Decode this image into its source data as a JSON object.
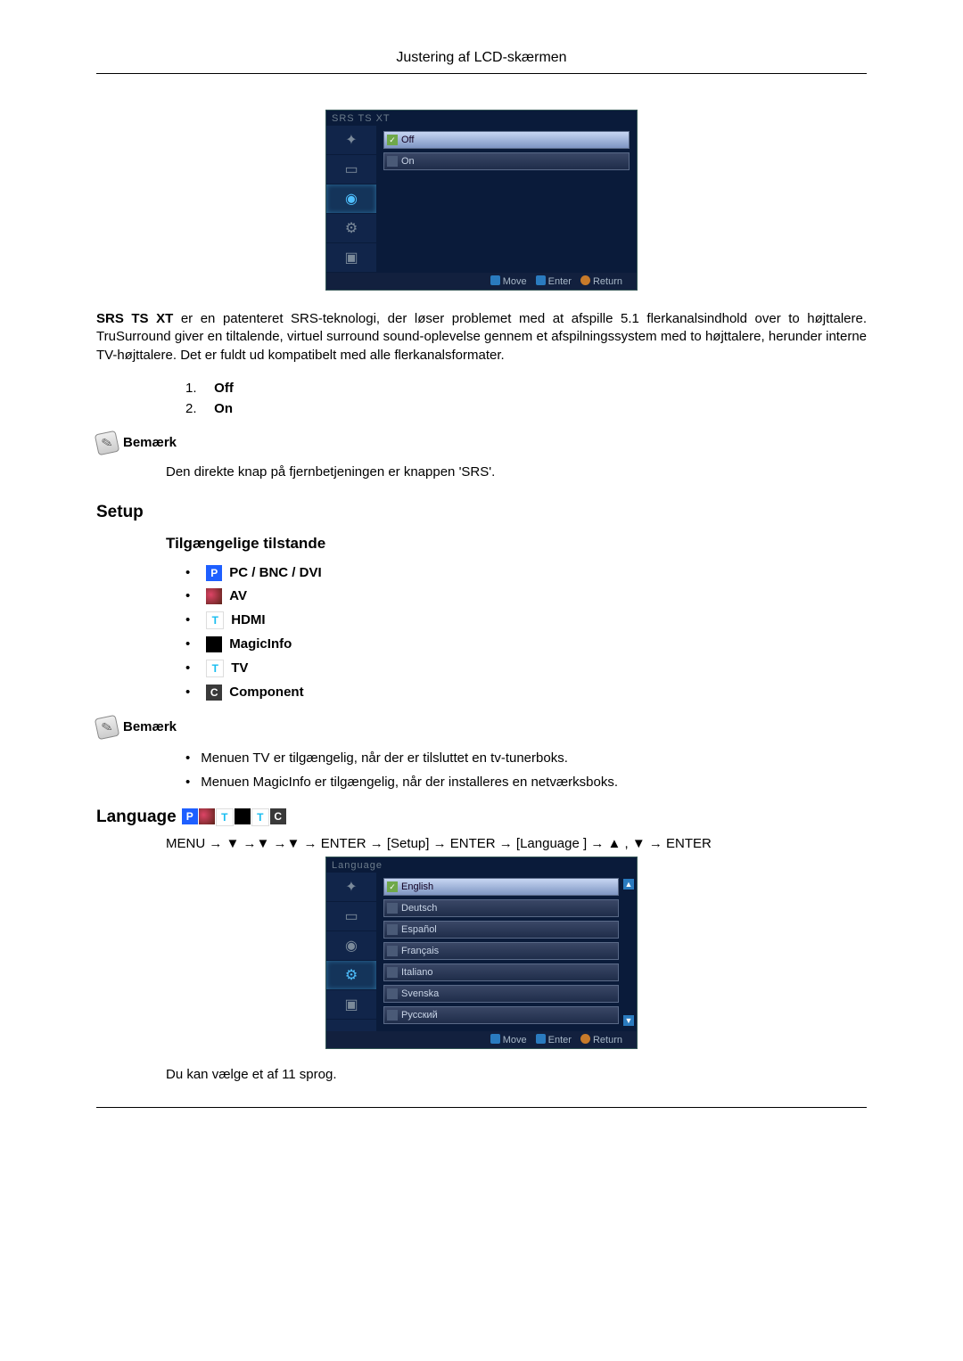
{
  "header": {
    "title": "Justering af LCD-skærmen"
  },
  "osd1": {
    "title": "SRS TS XT",
    "rows": [
      {
        "label": "Off",
        "selected": true
      },
      {
        "label": "On",
        "selected": false
      }
    ],
    "footer": {
      "move": "Move",
      "enter": "Enter",
      "return": "Return"
    }
  },
  "srs_paragraph_prefix": "SRS TS XT",
  "srs_paragraph_rest": " er en patenteret SRS-teknologi, der løser problemet med at afspille 5.1 flerkanalsindhold over to højttalere. TruSurround giver en tiltalende, virtuel surround sound-oplevelse gennem et afspilningssystem med to højttalere, herunder interne TV-højttalere. Det er fuldt ud kompatibelt med alle flerkanalsformater.",
  "list_items": [
    {
      "num": "1.",
      "label": "Off"
    },
    {
      "num": "2.",
      "label": "On"
    }
  ],
  "note_label": "Bemærk",
  "note_text": "Den direkte knap på fjernbetjeningen er knappen 'SRS'.",
  "setup_heading": "Setup",
  "modes_heading": "Tilgængelige tilstande",
  "modes": {
    "pc": "PC / BNC / DVI",
    "av": "AV",
    "hdmi": "HDMI",
    "magicinfo": "MagicInfo",
    "tv": "TV",
    "component": "Component"
  },
  "note2_items": [
    "Menuen TV er tilgængelig, når der er tilsluttet en tv-tunerboks.",
    "Menuen MagicInfo er tilgængelig, når der installeres en netværksboks."
  ],
  "language_heading": "Language",
  "menu_path": "MENU → ▼ →▼ →▼ → ENTER → [Setup] → ENTER → [Language ] → ▲ , ▼ → ENTER",
  "osd2": {
    "title": "Language",
    "rows": [
      "English",
      "Deutsch",
      "Español",
      "Français",
      "Italiano",
      "Svenska",
      "Русский"
    ],
    "footer": {
      "move": "Move",
      "enter": "Enter",
      "return": "Return"
    }
  },
  "language_text": "Du kan vælge et af 11 sprog.",
  "icon_badges": {
    "p": "P",
    "t": "T",
    "c": "C"
  }
}
